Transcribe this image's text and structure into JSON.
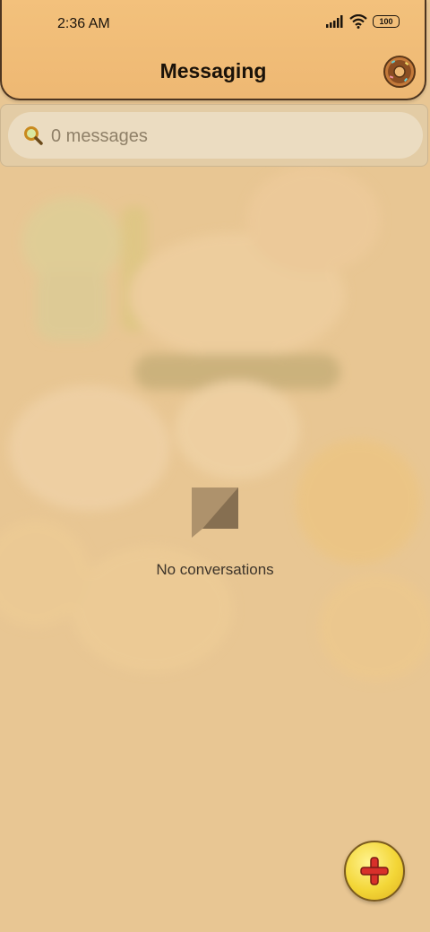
{
  "status_bar": {
    "time": "2:36 AM",
    "battery": "100",
    "icons": [
      "signal-icon",
      "wifi-icon",
      "battery-icon"
    ]
  },
  "header": {
    "title": "Messaging",
    "settings_icon": "donut-settings-icon"
  },
  "search": {
    "placeholder": "0 messages",
    "icon": "magnifier-icon"
  },
  "empty_state": {
    "icon": "chat-bubble-icon",
    "text": "No conversations"
  },
  "fab": {
    "icon": "plus-icon"
  },
  "colors": {
    "header": "#eeb873",
    "background": "#e8c693",
    "fab": "#f3d637",
    "plus": "#d8302a"
  }
}
